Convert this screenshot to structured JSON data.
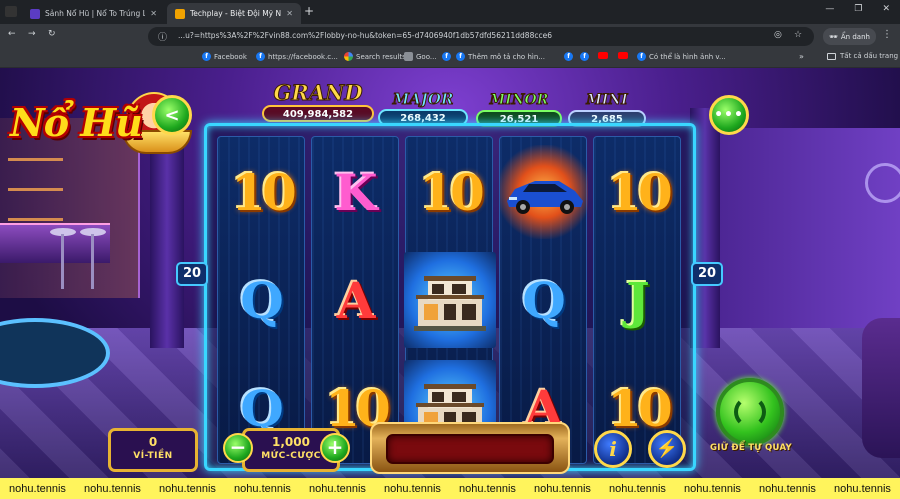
{
  "browser": {
    "tabs": [
      {
        "title": "Sảnh Nổ Hũ | Nổ To Trúng Lớ",
        "active": false
      },
      {
        "title": "Techplay - Biệt Đội Mỹ Nữ",
        "active": true
      }
    ],
    "new_tab_symbol": "+",
    "url": "...u?=https%3A%2F%2Fvin88.com%2Flobby-no-hu&token=65-d7406940f1db57dfd56211dd88cce6",
    "incognito_label": "Ẩn danh",
    "bookmarks": [
      {
        "label": "Facebook",
        "icon": "facebook-icon"
      },
      {
        "label": "https://facebook.c...",
        "icon": "facebook-icon"
      },
      {
        "label": "Search results",
        "icon": "google-icon"
      },
      {
        "label": "Goo...",
        "icon": "globe-icon"
      },
      {
        "label": "",
        "icon": "facebook-icon"
      },
      {
        "label": "Thêm mô tả cho hìn...",
        "icon": "facebook-icon"
      },
      {
        "label": "",
        "icon": "facebook-icon"
      },
      {
        "label": "",
        "icon": "facebook-icon"
      },
      {
        "label": "",
        "icon": "youtube-icon"
      },
      {
        "label": "",
        "icon": "youtube-icon"
      },
      {
        "label": "Có thể là hình ảnh v...",
        "icon": "facebook-icon"
      }
    ],
    "all_bookmarks_label": "Tất cả dấu trang"
  },
  "game": {
    "logo_text": "Nổ Hũ",
    "jackpots": {
      "grand": {
        "title": "GRAND",
        "value": "409,984,582"
      },
      "major": {
        "title": "MAJOR",
        "value": "268,432"
      },
      "minor": {
        "title": "MINOR",
        "value": "26,521"
      },
      "mini": {
        "title": "MINI",
        "value": "2,685"
      }
    },
    "lines_left": "20",
    "lines_right": "20",
    "reels": [
      [
        "10",
        "Q",
        "Q"
      ],
      [
        "K",
        "A",
        "10"
      ],
      [
        "10",
        "building",
        "building"
      ],
      [
        "car",
        "Q",
        "A"
      ],
      [
        "10",
        "J",
        "10"
      ]
    ],
    "wallet": {
      "value": "0",
      "label": "VÍ-TIỀN"
    },
    "bet": {
      "value": "1,000",
      "label": "MỨC-CƯỢC",
      "minus": "−",
      "plus": "+"
    },
    "info_symbol": "i",
    "turbo_symbol": "⚡",
    "auto_spin_label": "GIỮ ĐỂ TỰ QUAY"
  },
  "watermark": {
    "text": "nohu.tennis",
    "repeat": 12
  }
}
